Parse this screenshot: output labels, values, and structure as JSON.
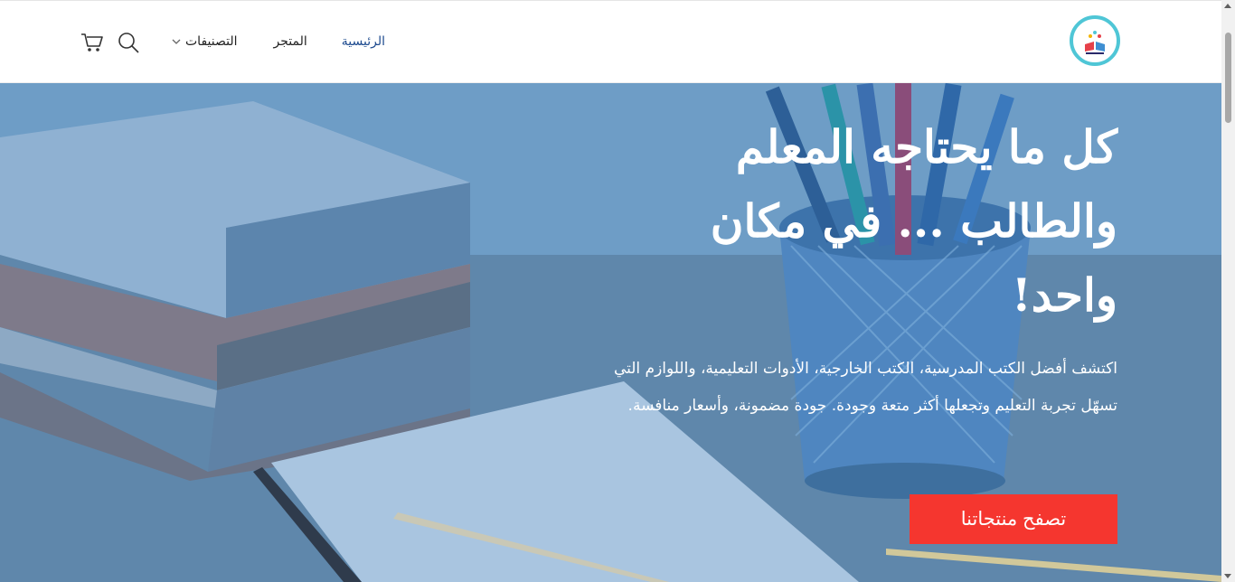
{
  "header": {
    "logo_icon": "bookstore-logo",
    "nav": {
      "home": "الرئيسية",
      "store": "المتجر",
      "categories": "التصنيفات"
    },
    "icons": {
      "search": "search-icon",
      "cart": "cart-icon",
      "chevron": "chevron-down-icon"
    },
    "active_color": "#1e4b8f"
  },
  "hero": {
    "title": "كل ما يحتاجه المعلم والطالب ... في مكان واحد!",
    "description": "اكتشف أفضل الكتب المدرسية، الكتب الخارجية، الأدوات التعليمية، واللوازم التي تسهّل تجربة التعليم وتجعلها أكثر متعة وجودة. جودة مضمونة، وأسعار منافسة.",
    "cta_label": "تصفح منتجاتنا",
    "cta_color": "#f5362f",
    "overlay_color": "#6d9cc4"
  }
}
